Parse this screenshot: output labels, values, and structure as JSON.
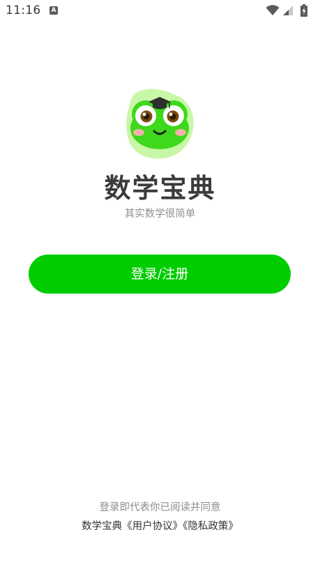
{
  "status_bar": {
    "time": "11:16",
    "notification_icon": "a-icon",
    "icons": [
      "wifi-icon",
      "signal-icon",
      "battery-charging-icon"
    ]
  },
  "app": {
    "name": "数学宝典",
    "slogan": "其实数学很简单",
    "logo": "frog-graduate-logo"
  },
  "login": {
    "button_label": "登录/注册"
  },
  "agreement": {
    "prefix": "登录即代表你已阅读并同意",
    "app_name": "数学宝典",
    "user_agreement": "《用户协议》",
    "privacy_policy": "《隐私政策》"
  },
  "colors": {
    "brand_green": "#00cc00",
    "logo_light_green": "#c9f7a8",
    "logo_green": "#3ed81c",
    "text_dark": "#3b3b3b",
    "text_gray": "#8f8f8f"
  }
}
